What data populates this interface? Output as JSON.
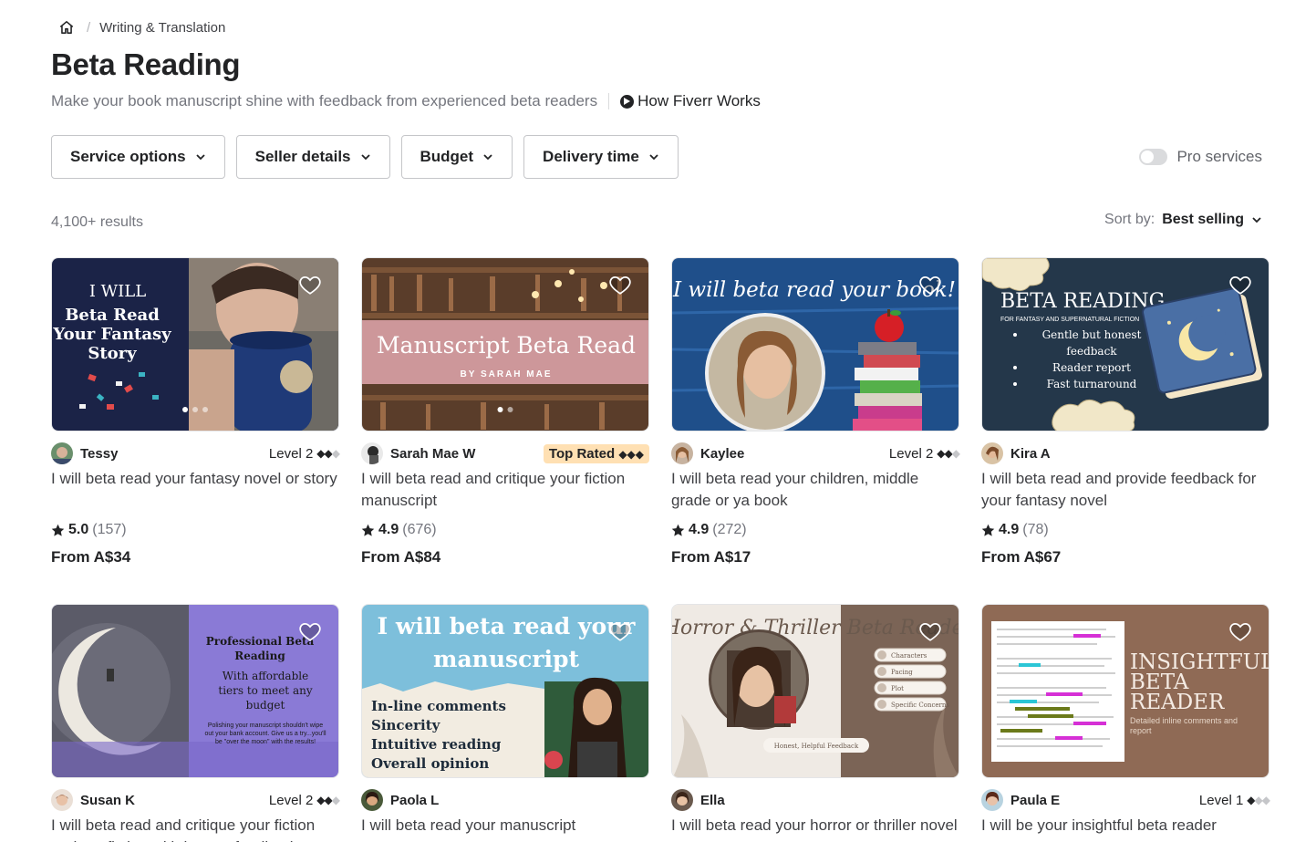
{
  "breadcrumb": {
    "home_icon": "home-icon",
    "category": "Writing & Translation"
  },
  "header": {
    "title": "Beta Reading",
    "subtitle": "Make your book manuscript shine with feedback from experienced beta readers",
    "how_works": "How Fiverr Works"
  },
  "filters": {
    "service_options": "Service options",
    "seller_details": "Seller details",
    "budget": "Budget",
    "delivery_time": "Delivery time",
    "pro_services": "Pro services",
    "pro_enabled": false
  },
  "results": {
    "count": "4,100+ results",
    "sort_label": "Sort by:",
    "sort_value": "Best selling"
  },
  "thumb_text": {
    "t1_l1": "I WILL",
    "t1_l2": "Beta Read",
    "t1_l3": "Your Fantasy",
    "t1_l4": "Story",
    "t2_l1": "Manuscript Beta Read",
    "t2_l2": "BY SARAH MAE",
    "t3_l1": "I will beta read your book!",
    "t4_l1": "BETA READING",
    "t4_l2": "FOR FANTASY AND SUPERNATURAL FICTION",
    "t4_l3": "Gentle but honest",
    "t4_l4": "feedback",
    "t4_l5": "Reader report",
    "t4_l6": "Fast turnaround",
    "t5_l1": "Professional Beta",
    "t5_l2": "Reading",
    "t5_l3": "With affordable",
    "t5_l4": "tiers to meet any",
    "t5_l5": "budget",
    "t5_l6": "Polishing your manuscript shouldn't wipe",
    "t5_l7": "out your bank account. Give us a try...you'll",
    "t5_l8": "be \"over the moon\" with the results!",
    "t6_l1": "I will beta read your",
    "t6_l2": "manuscript",
    "t6_l3": "In-line comments",
    "t6_l4": "Sincerity",
    "t6_l5": "Intuitive reading",
    "t6_l6": "Overall opinion",
    "t7_l1": "Horror & Thriller Beta Reader",
    "t7_l2": "Characters",
    "t7_l3": "Pacing",
    "t7_l4": "Plot",
    "t7_l5": "Specific Concerns",
    "t7_l6": "Honest, Helpful Feedback",
    "t8_l1": "INSIGHTFUL",
    "t8_l2": "BETA",
    "t8_l3": "READER",
    "t8_l4": "Detailed inline comments and",
    "t8_l5": "report"
  },
  "gigs": [
    {
      "seller": "Tessy",
      "badge": "Level 2",
      "badge_type": "level",
      "diamonds_on": 2,
      "title": "I will beta read your fantasy novel or story",
      "score": "5.0",
      "reviews": "(157)",
      "price": "From A$34"
    },
    {
      "seller": "Sarah Mae W",
      "badge": "Top Rated",
      "badge_type": "top",
      "diamonds_on": 3,
      "title": "I will beta read and critique your fiction manuscript",
      "score": "4.9",
      "reviews": "(676)",
      "price": "From A$84"
    },
    {
      "seller": "Kaylee",
      "badge": "Level 2",
      "badge_type": "level",
      "diamonds_on": 2,
      "title": "I will beta read your children, middle grade or ya book",
      "score": "4.9",
      "reviews": "(272)",
      "price": "From A$17"
    },
    {
      "seller": "Kira A",
      "badge": "",
      "badge_type": "none",
      "diamonds_on": 0,
      "title": "I will beta read and provide feedback for your fantasy novel",
      "score": "4.9",
      "reviews": "(78)",
      "price": "From A$67"
    },
    {
      "seller": "Susan K",
      "badge": "Level 2",
      "badge_type": "level",
      "diamonds_on": 2,
      "title": "I will beta read and critique your fiction and nonfiction with honest feedback",
      "score": "",
      "reviews": "",
      "price": ""
    },
    {
      "seller": "Paola L",
      "badge": "",
      "badge_type": "none",
      "diamonds_on": 0,
      "title": "I will beta read your manuscript",
      "score": "",
      "reviews": "",
      "price": ""
    },
    {
      "seller": "Ella",
      "badge": "",
      "badge_type": "none",
      "diamonds_on": 0,
      "title": "I will beta read your horror or thriller novel",
      "score": "",
      "reviews": "",
      "price": ""
    },
    {
      "seller": "Paula E",
      "badge": "Level 1",
      "badge_type": "level",
      "diamonds_on": 1,
      "title": "I will be your insightful beta reader",
      "score": "",
      "reviews": "",
      "price": ""
    }
  ],
  "colors": {
    "text": "#222325",
    "muted": "#74767e",
    "border": "#c5c6c9",
    "top_rated_bg": "#ffe0b3"
  }
}
